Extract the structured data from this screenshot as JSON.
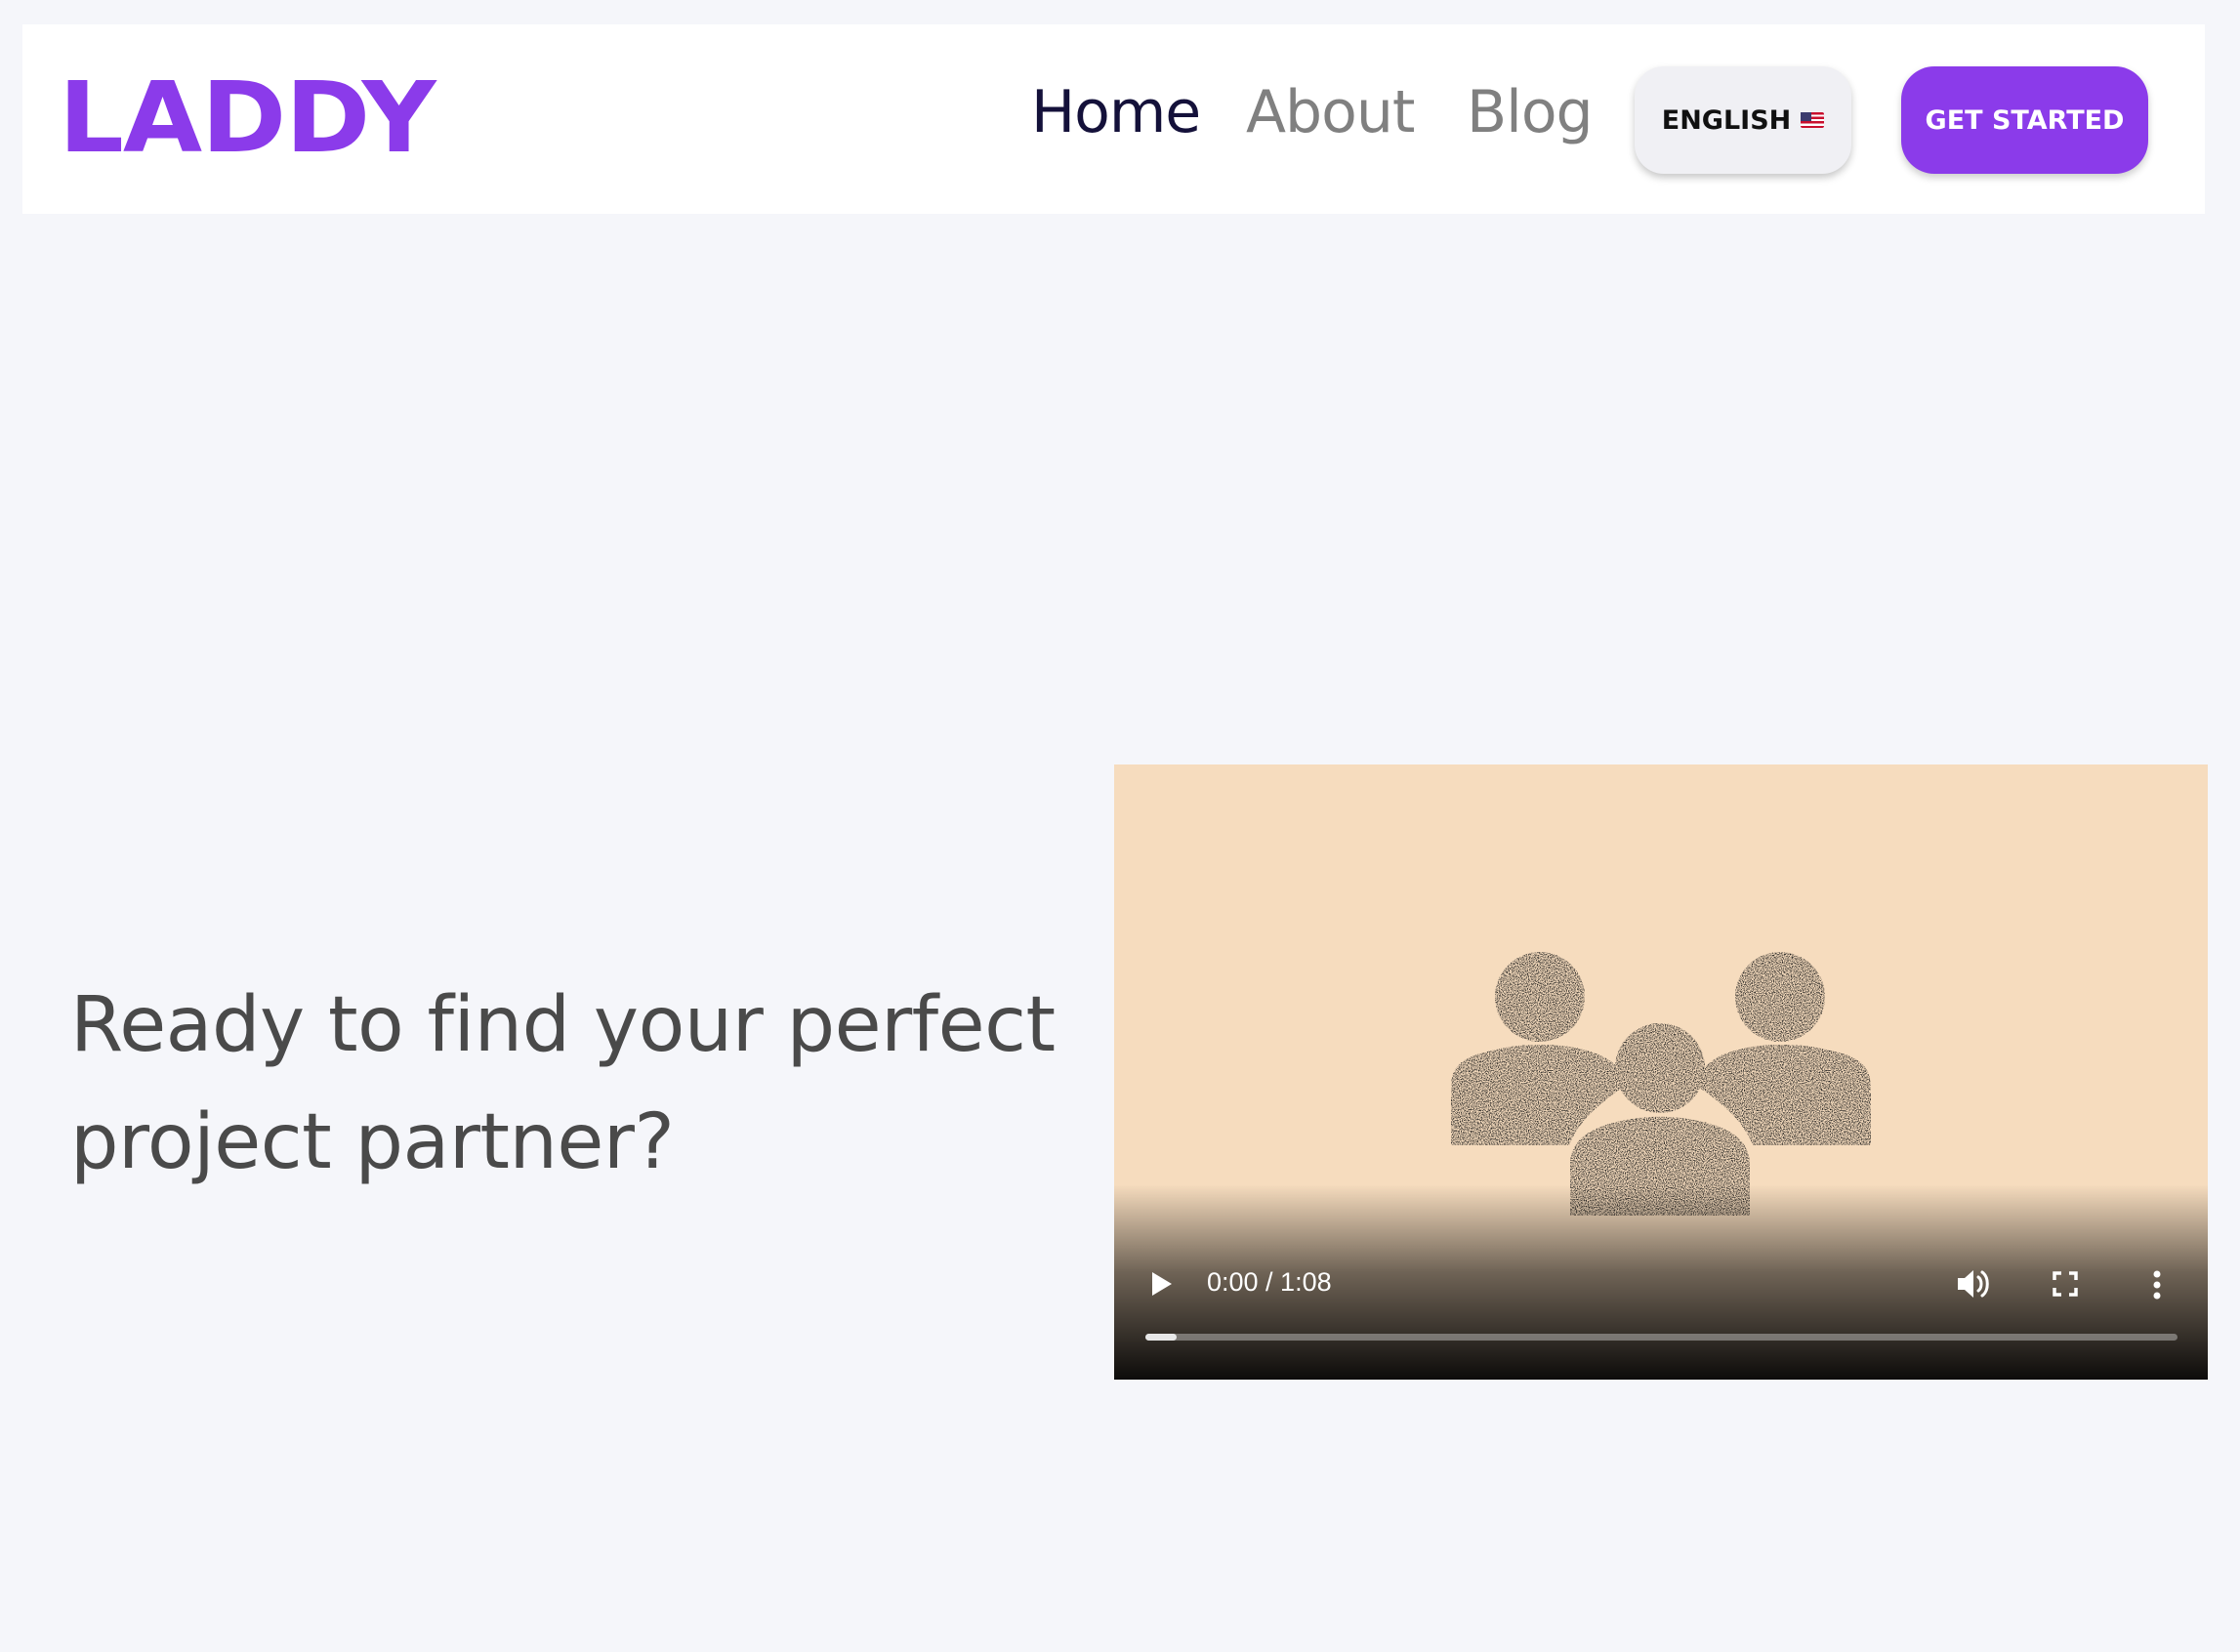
{
  "header": {
    "logo": "LADDY",
    "nav": {
      "home": "Home",
      "about": "About",
      "blog": "Blog"
    },
    "language_button": "ENGLISH",
    "language_flag": "flag-us-icon",
    "cta_button": "GET STARTED"
  },
  "hero": {
    "title": "Ready to find your perfect project partner?"
  },
  "video": {
    "time_display": "0:00 / 1:08",
    "progress_fraction": 0.03,
    "illustration": "team-people-icon"
  },
  "colors": {
    "brand": "#8b3bea",
    "nav_active": "#14113a",
    "nav_inactive": "#808080",
    "page_background": "#f5f6fa",
    "video_background": "#f6dcbe"
  }
}
